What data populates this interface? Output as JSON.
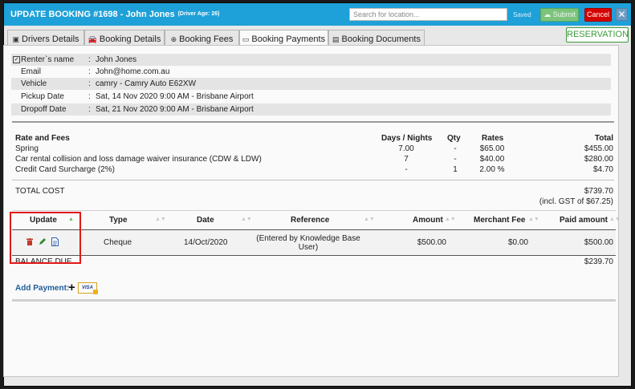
{
  "window": {
    "title": "UPDATE BOOKING #1698 - John Jones",
    "driver_age": "(Driver Age: 26)",
    "search_placeholder": "Search for location...",
    "saved_label": "Saved",
    "submit_label": "Submit",
    "cancel_label": "Cancel",
    "close_label": "✕"
  },
  "tabs": [
    {
      "label": "Drivers Details",
      "icon": "id-card-icon",
      "active": false
    },
    {
      "label": "Booking Details",
      "icon": "car-icon",
      "active": false
    },
    {
      "label": "Booking Fees",
      "icon": "plus-circle-icon",
      "active": false
    },
    {
      "label": "Booking Payments",
      "icon": "credit-card-icon",
      "active": true
    },
    {
      "label": "Booking Documents",
      "icon": "document-icon",
      "active": false
    }
  ],
  "reservation_label": "RESERVATION",
  "info": [
    {
      "key": "Renter`s name",
      "value": "John Jones"
    },
    {
      "key": "Email",
      "value": "John@home.com.au"
    },
    {
      "key": "Vehicle",
      "value": "camry - Camry Auto E62XW"
    },
    {
      "key": "Pickup Date",
      "value": "Sat, 14 Nov 2020 9:00 AM - Brisbane Airport"
    },
    {
      "key": "Dropoff Date",
      "value": "Sat, 21 Nov 2020 9:00 AM - Brisbane Airport"
    }
  ],
  "fees": {
    "headers": {
      "name": "Rate and Fees",
      "days": "Days / Nights",
      "qty": "Qty",
      "rates": "Rates",
      "total": "Total"
    },
    "rows": [
      {
        "name": "Spring",
        "days": "7.00",
        "qty": "-",
        "rate": "$65.00",
        "total": "$455.00"
      },
      {
        "name": "Car rental collision and loss damage waiver insurance (CDW & LDW)",
        "days": "7",
        "qty": "-",
        "rate": "$40.00",
        "total": "$280.00"
      },
      {
        "name": "Credit Card Surcharge (2%)",
        "days": "-",
        "qty": "1",
        "rate": "2.00 %",
        "total": "$4.70"
      }
    ],
    "total_label": "TOTAL COST",
    "total_value": "$739.70",
    "gst_note": "(incl. GST of $67.25)"
  },
  "payments": {
    "headers": {
      "update": "Update",
      "type": "Type",
      "date": "Date",
      "reference": "Reference",
      "amount": "Amount",
      "merchant_fee": "Merchant Fee",
      "paid_amount": "Paid amount"
    },
    "rows": [
      {
        "type": "Cheque",
        "date": "14/Oct/2020",
        "reference_line1": "(Entered by Knowledge Base",
        "reference_line2": "User)",
        "amount": "$500.00",
        "merchant_fee": "$0.00",
        "paid_amount": "$500.00"
      }
    ],
    "balance_label": "BALANCE DUE",
    "balance_value": "$239.70"
  },
  "add_payment_label": "Add Payment:",
  "visa_label": "VISA",
  "colors": {
    "titlebar": "#1ea0d8",
    "submit": "#7cc47c",
    "cancel": "#d40000",
    "reservation": "#3b9a3b",
    "highlight": "#e01818",
    "link": "#1f5d9a"
  }
}
